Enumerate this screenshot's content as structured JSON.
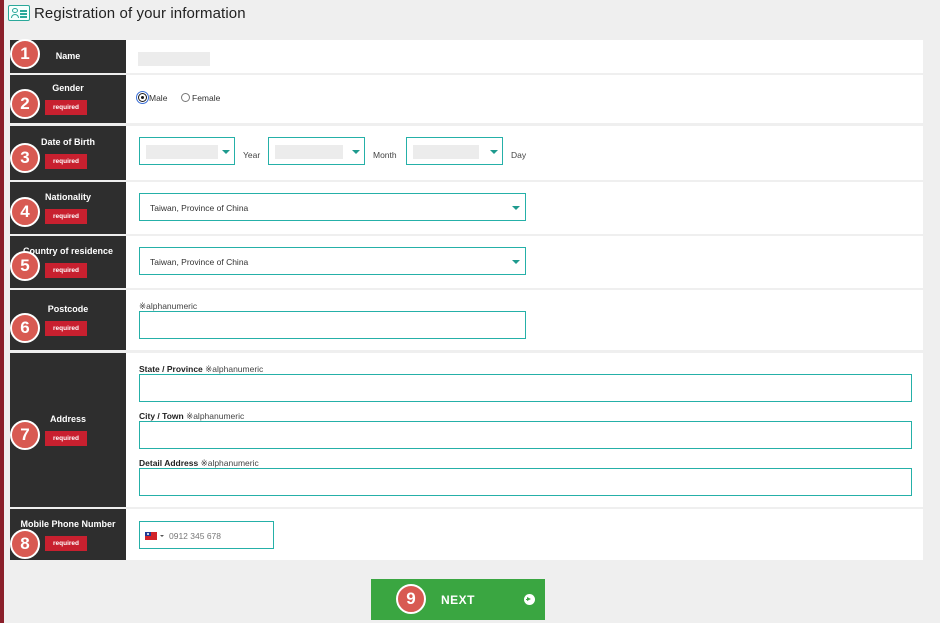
{
  "page": {
    "title": "Registration of your information",
    "title_icon": "profile-card-icon"
  },
  "colors": {
    "label_bg": "#2e2e2e",
    "required_badge": "#c8202f",
    "number_badge": "#d85a52",
    "input_border": "#25b0a8",
    "next_button": "#3aa641"
  },
  "required_text": "required",
  "fields": {
    "name": {
      "number": "1",
      "label": "Name"
    },
    "gender": {
      "number": "2",
      "label": "Gender",
      "options": [
        "Male",
        "Female"
      ],
      "selected": "Male"
    },
    "dob": {
      "number": "3",
      "label": "Date of Birth",
      "year_label": "Year",
      "month_label": "Month",
      "day_label": "Day"
    },
    "nationality": {
      "number": "4",
      "label": "Nationality",
      "value": "Taiwan, Province of China"
    },
    "residence": {
      "number": "5",
      "label": "Country of residence",
      "value": "Taiwan, Province of China"
    },
    "postcode": {
      "number": "6",
      "label": "Postcode",
      "hint": "※alphanumeric"
    },
    "address": {
      "number": "7",
      "label": "Address",
      "state_label": "State / Province",
      "city_label": "City / Town",
      "detail_label": "Detail Address",
      "hint": "※alphanumeric"
    },
    "phone": {
      "number": "8",
      "label": "Mobile Phone Number",
      "placeholder": "0912 345 678",
      "flag_icon": "taiwan-flag-icon"
    }
  },
  "next_button": {
    "number": "9",
    "label": "NEXT",
    "icon": "arrow-circle-right-icon"
  }
}
